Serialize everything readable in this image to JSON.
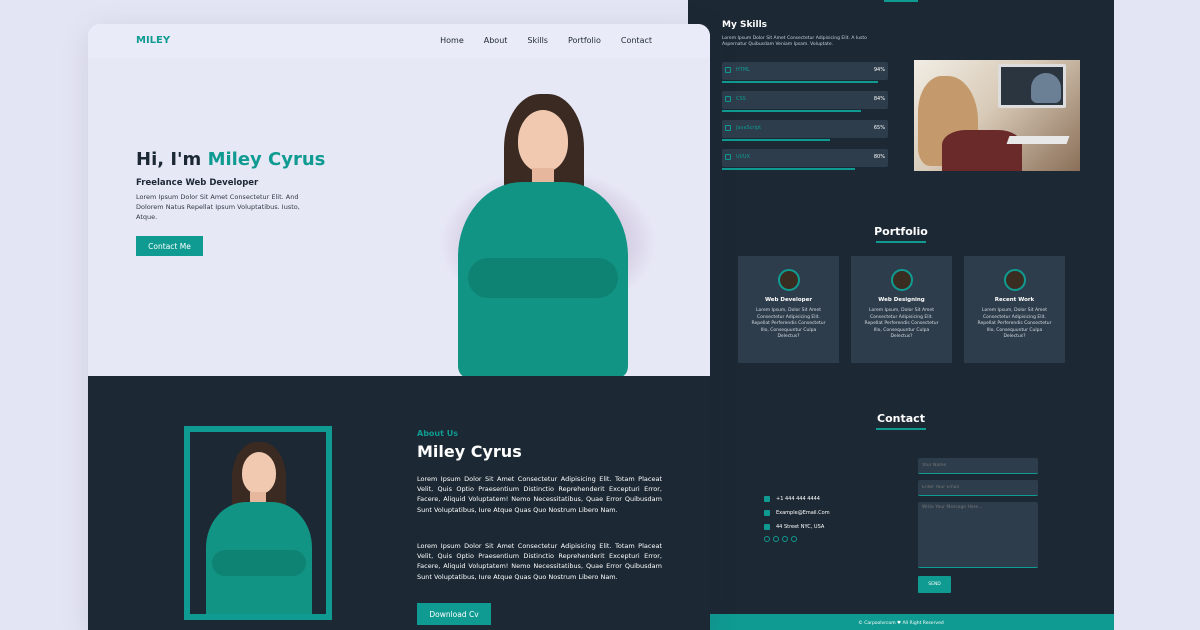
{
  "nav": {
    "logo": "MILEY",
    "links": [
      "Home",
      "About",
      "Skills",
      "Portfolio",
      "Contact"
    ]
  },
  "hero": {
    "title_prefix": "Hi, I'm ",
    "title_name": "Miley Cyrus",
    "subtitle": "Freelance Web Developer",
    "description": "Lorem Ipsum Dolor Sit Amet Consectetur Elit. And Dolorem Natus Repellat Ipsum Voluptatibus. Iusto, Atque.",
    "button": "Contact Me"
  },
  "about": {
    "tag": "About Us",
    "title": "Miley Cyrus",
    "paragraph_1": "Lorem Ipsum Dolor Sit Amet Consectetur Adipisicing Elit. Totam Placeat Velit, Quis Optio Praesentium Distinctio Reprehenderit Excepturi Error, Facere, Aliquid Voluptatem! Nemo Necessitatibus, Quae Error Quibusdam Sunt Voluptatibus, Iure Atque Quas Quo Nostrum Libero Nam.",
    "paragraph_2": "Lorem Ipsum Dolor Sit Amet Consectetur Adipisicing Elit. Totam Placeat Velit, Quis Optio Praesentium Distinctio Reprehenderit Excepturi Error, Facere, Aliquid Voluptatem! Nemo Necessitatibus, Quae Error Quibusdam Sunt Voluptatibus, Iure Atque Quas Quo Nostrum Libero Nam.",
    "button": "Download Cv"
  },
  "skills": {
    "title": "My Skills",
    "description": "Lorem Ipsum Dolor Sit Amet Consectetur Adipisicing Elit. A Iusto Aspernatur Quibusdam Veniam Ipsam. Voluptate.",
    "items": [
      {
        "name": "HTML",
        "percent_label": "94%",
        "level": 0.94
      },
      {
        "name": "CSS",
        "percent_label": "84%",
        "level": 0.84
      },
      {
        "name": "JavaScript",
        "percent_label": "65%",
        "level": 0.65
      },
      {
        "name": "UI/UX",
        "percent_label": "80%",
        "level": 0.8
      }
    ]
  },
  "portfolio": {
    "title": "Portfolio",
    "cards": [
      {
        "title": "Web Developer",
        "text": "Lorem Ipsum, Dolor Sit Amet Consectetur Adipisicing Elit. Repellat Perferendis Consectetur Illo, Consequuntur Culpa Delectus?"
      },
      {
        "title": "Web Designing",
        "text": "Lorem Ipsum, Dolor Sit Amet Consectetur Adipisicing Elit. Repellat Perferendis Consectetur Illo, Consequuntur Culpa Delectus?"
      },
      {
        "title": "Recent Work",
        "text": "Lorem Ipsum, Dolor Sit Amet Consectetur Adipisicing Elit. Repellat Perferendis Consectetur Illo, Consequuntur Culpa Delectus?"
      }
    ]
  },
  "contact": {
    "title": "Contact",
    "phone": "+1 444 444 4444",
    "email": "Example@Email.Com",
    "address": "44 Street NYC, USA",
    "name_placeholder": "Your Name",
    "email_placeholder": "Enter Your Email",
    "message_placeholder": "Write Your Message Here...",
    "send": "SEND"
  },
  "footer": {
    "text": "© Carpoolvrcom ♥ All Right Reserved"
  },
  "colors": {
    "accent": "#0f9b91",
    "dark": "#1c2833",
    "light_bg": "#e7e8f6"
  }
}
